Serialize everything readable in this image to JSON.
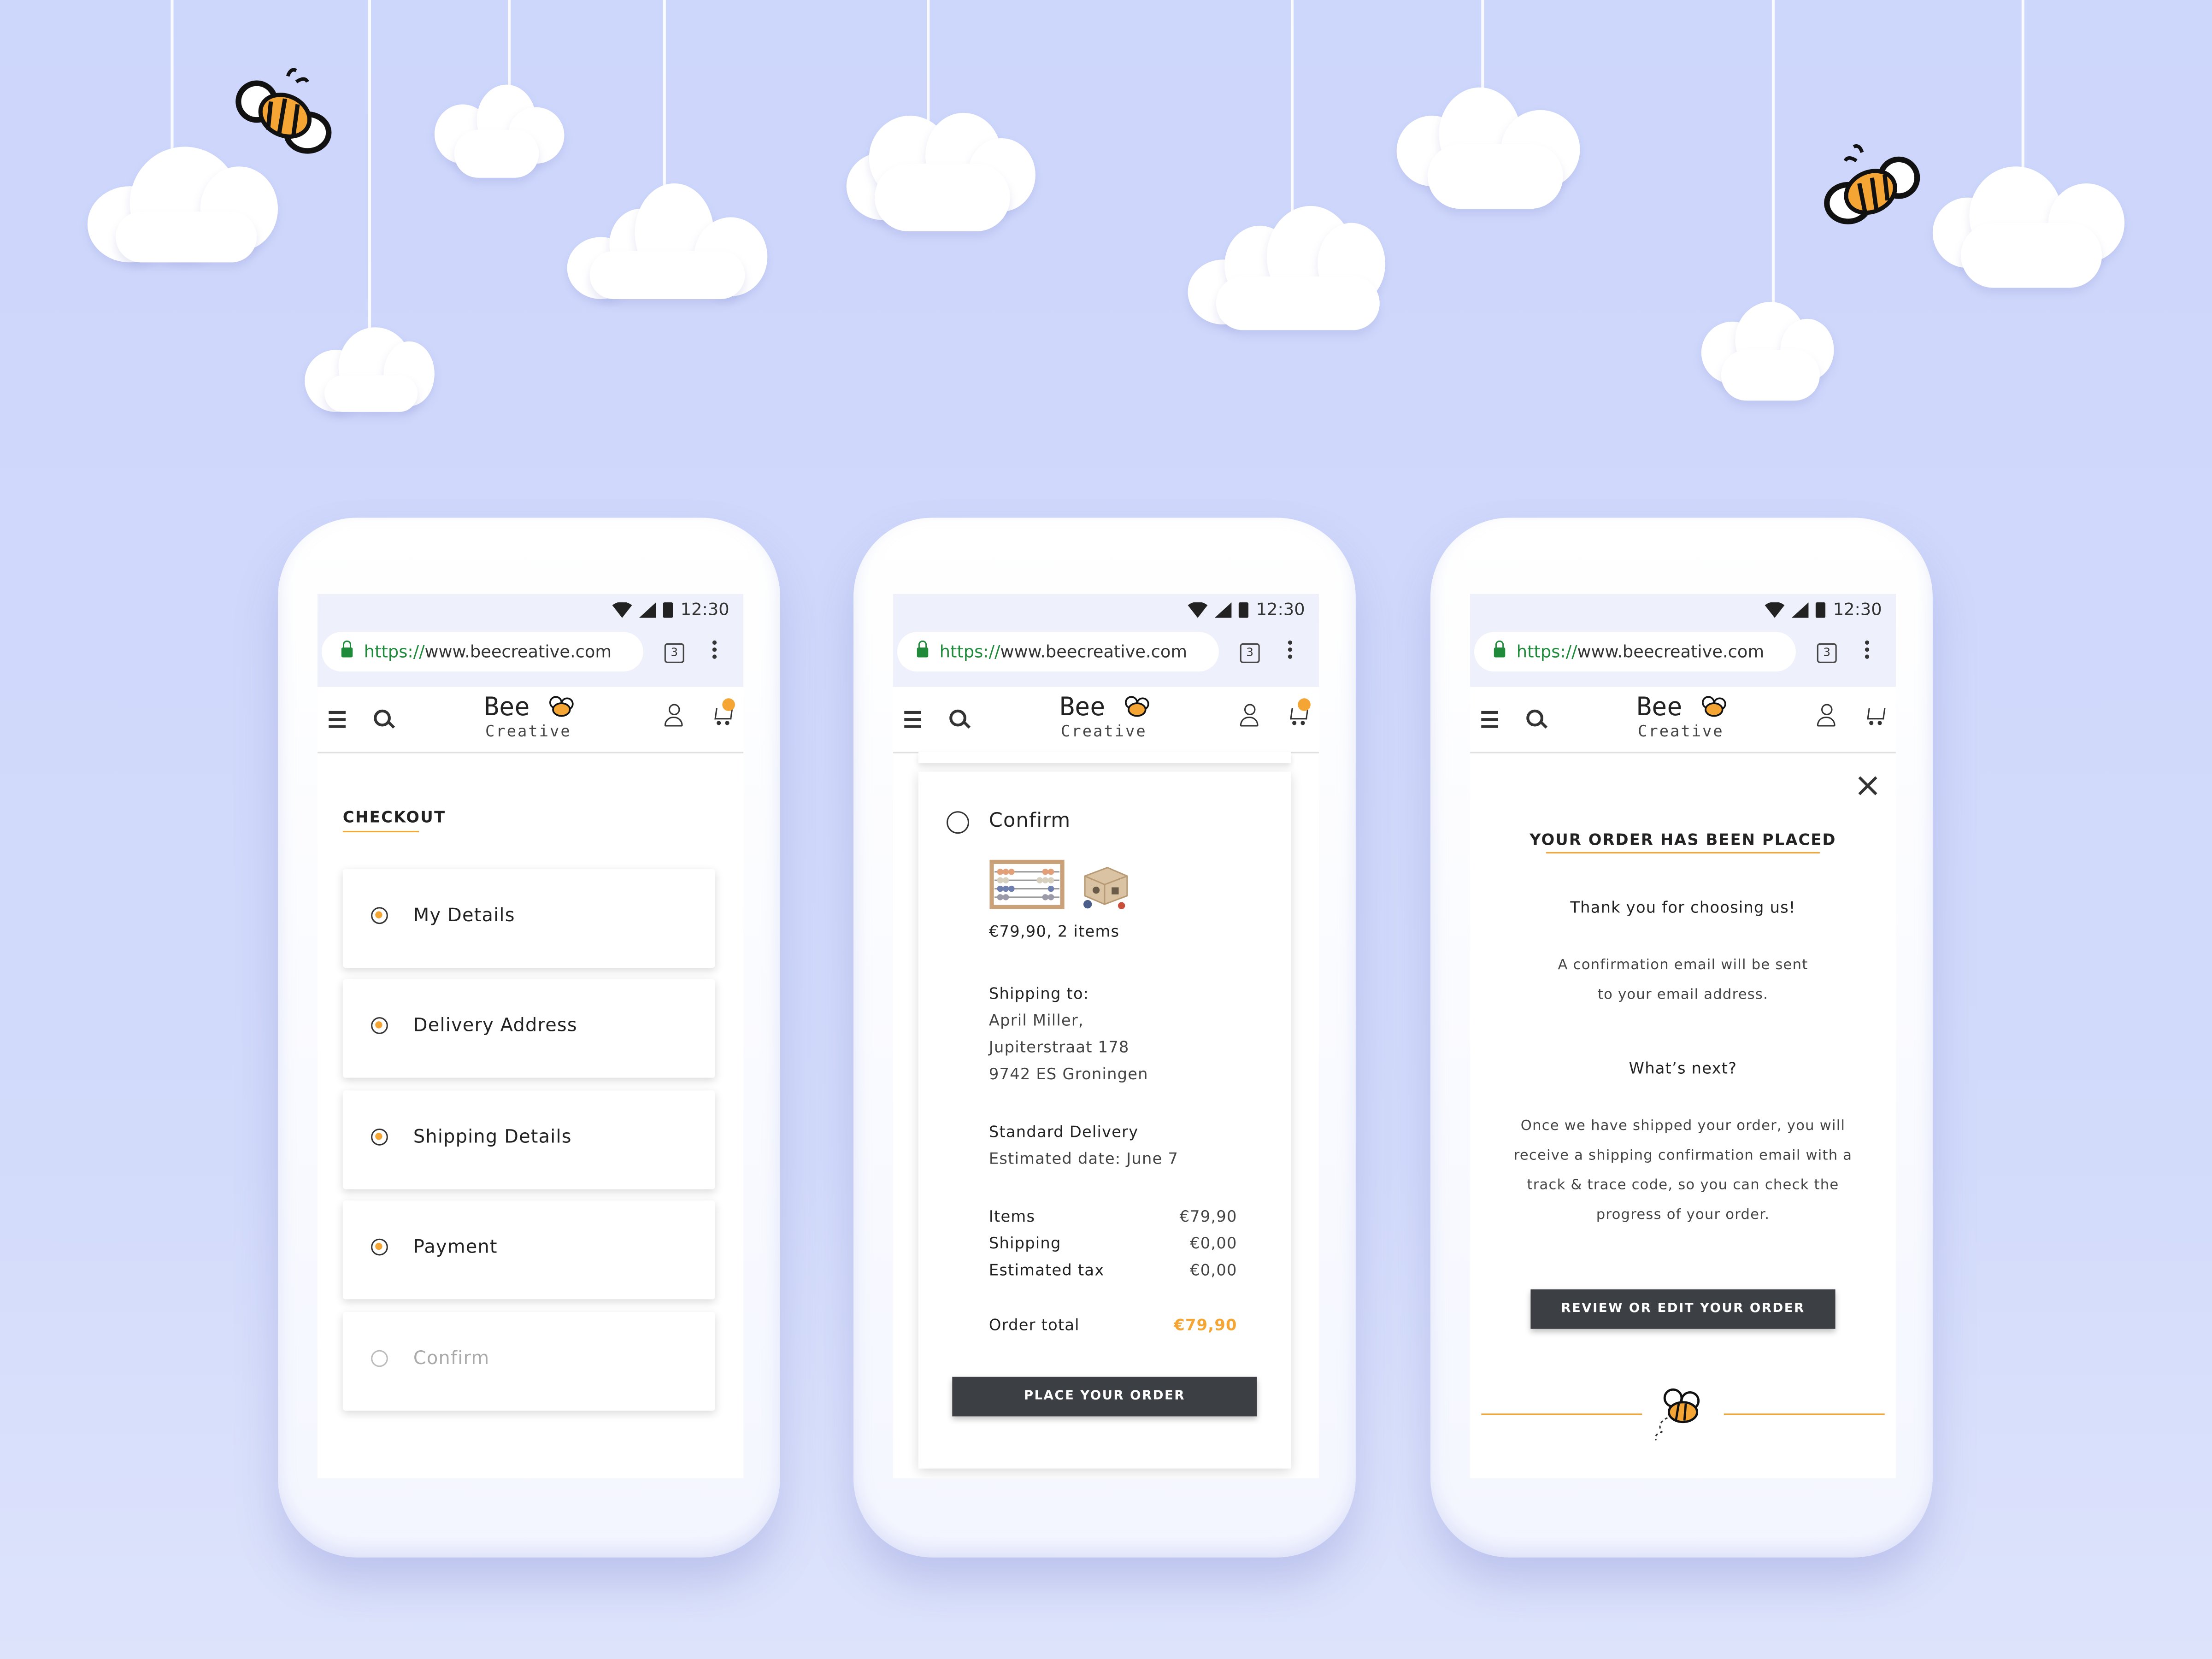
{
  "decor": {
    "clouds": [
      "cloud",
      "cloud",
      "cloud",
      "cloud",
      "cloud",
      "cloud",
      "cloud",
      "cloud",
      "cloud",
      "cloud"
    ],
    "bees": [
      "bee-icon",
      "bee-icon"
    ]
  },
  "status_bar": {
    "time": "12:30",
    "icons": [
      "wifi-icon",
      "signal-icon",
      "battery-icon"
    ]
  },
  "browser": {
    "url_scheme": "https://",
    "url_host": "www.beecreative.com",
    "tab_count": "3"
  },
  "brand": {
    "logo_top": "Bee",
    "logo_bottom": "Creative"
  },
  "colors": {
    "background": "#cdd6fb",
    "accent": "#f4a533",
    "button": "#3c3f44"
  },
  "screen1": {
    "title": "CHECKOUT",
    "steps": [
      {
        "label": "My Details",
        "state": "done"
      },
      {
        "label": "Delivery Address",
        "state": "done"
      },
      {
        "label": "Shipping Details",
        "state": "done"
      },
      {
        "label": "Payment",
        "state": "done"
      },
      {
        "label": "Confirm",
        "state": "pending"
      }
    ]
  },
  "screen2": {
    "step_label": "Confirm",
    "summary": "€79,90, 2 items",
    "shipping_to_label": "Shipping to:",
    "address": [
      "April Miller,",
      "Jupiterstraat 178",
      "9742 ES Groningen"
    ],
    "delivery_method": "Standard Delivery",
    "estimated_date": "Estimated date: June 7",
    "totals": [
      {
        "label": "Items",
        "value": "€79,90"
      },
      {
        "label": "Shipping",
        "value": "€0,00"
      },
      {
        "label": "Estimated tax",
        "value": "€0,00"
      }
    ],
    "order_total_label": "Order total",
    "order_total_value": "€79,90",
    "place_order_button": "PLACE YOUR ORDER"
  },
  "screen3": {
    "title": "YOUR ORDER HAS BEEN PLACED",
    "thanks": "Thank you for choosing us!",
    "confirmation_line1": "A confirmation email will be sent",
    "confirmation_line2": "to your email address.",
    "whats_next": "What’s next?",
    "next_lines": [
      "Once we have shipped your order, you will",
      "receive a shipping confirmation email with a",
      "track & trace code, so you can check the",
      "progress of your order."
    ],
    "review_button": "REVIEW OR EDIT YOUR ORDER"
  }
}
